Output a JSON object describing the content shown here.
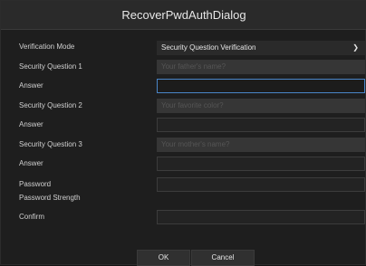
{
  "dialog": {
    "title": "RecoverPwdAuthDialog"
  },
  "form": {
    "verification_mode_label": "Verification Mode",
    "verification_mode_value": "Security Question Verification",
    "q1_label": "Security Question 1",
    "q1_value": "Your father's name?",
    "a1_label": "Answer",
    "q2_label": "Security Question 2",
    "q2_value": "Your favorite color?",
    "a2_label": "Answer",
    "q3_label": "Security Question 3",
    "q3_value": "Your mother's name?",
    "a3_label": "Answer",
    "password_label": "Password",
    "password_strength_label": "Password Strength",
    "confirm_label": "Confirm"
  },
  "buttons": {
    "ok": "OK",
    "cancel": "Cancel"
  },
  "icons": {
    "dropdown": "chevron-down-icon"
  },
  "colors": {
    "background": "#1e1e1e",
    "focus_border": "#4a86c8"
  }
}
